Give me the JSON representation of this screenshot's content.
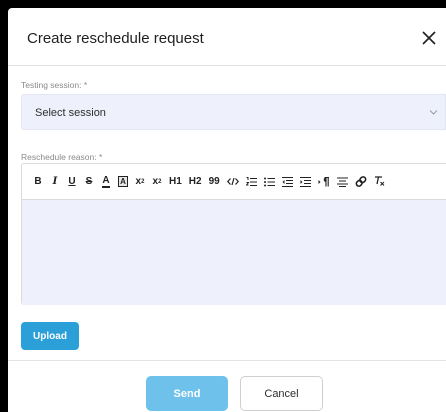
{
  "dialog": {
    "title": "Create reschedule request"
  },
  "session_field": {
    "label": "Testing session: *",
    "value": "Select session"
  },
  "reason_field": {
    "label": "Reschedule reason: *",
    "toolbar": {
      "bold": "B",
      "italic": "I",
      "underline": "U",
      "strike": "S",
      "text_color": "A",
      "bg_color": "A",
      "subscript": "x",
      "subscript_mark": "2",
      "superscript": "x",
      "superscript_mark": "2",
      "heading1": "H1",
      "heading2": "H2",
      "blockquote": "99"
    }
  },
  "upload": {
    "label": "Upload"
  },
  "footer": {
    "send_label": "Send",
    "cancel_label": "Cancel"
  },
  "colors": {
    "accent": "#2a9fd8",
    "send_disabled": "#6ec1eb",
    "field_bg": "#eef1fb"
  }
}
